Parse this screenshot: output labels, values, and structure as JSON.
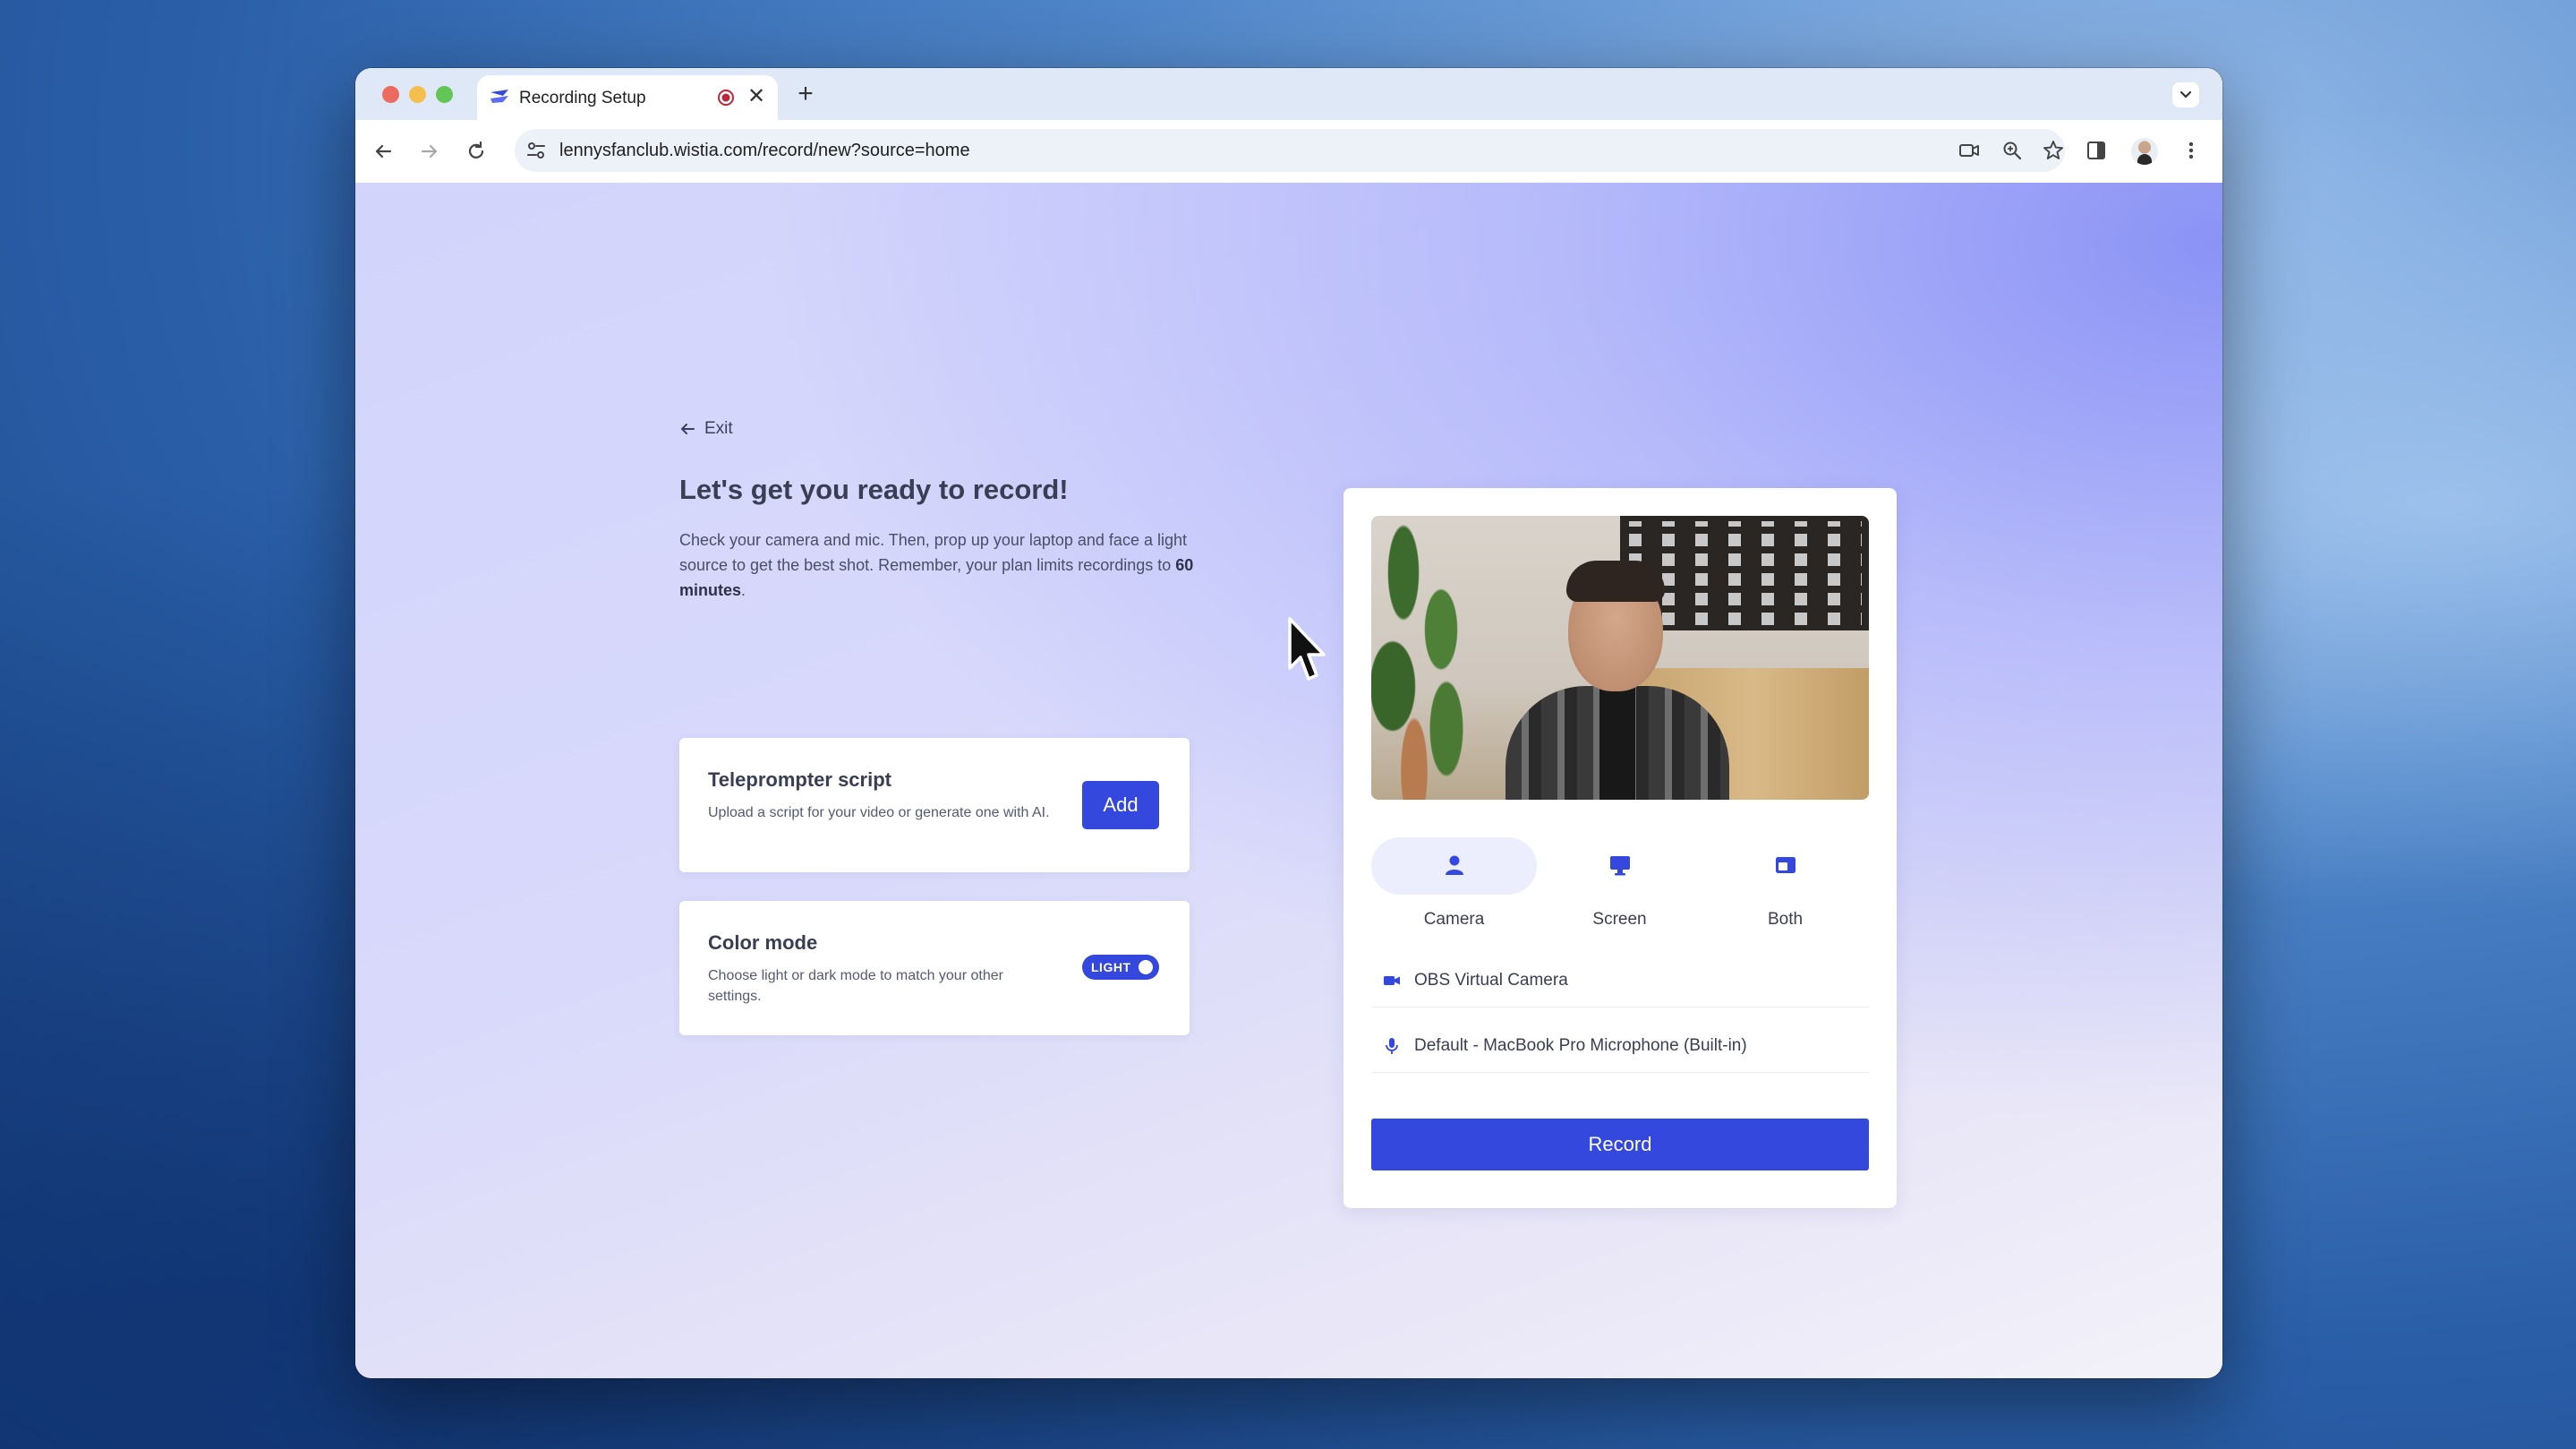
{
  "browser": {
    "tab_title": "Recording Setup",
    "url": "lennysfanclub.wistia.com/record/new?source=home"
  },
  "page": {
    "exit_label": "Exit",
    "heading": "Let's get you ready to record!",
    "intro_before": "Check your camera and mic. Then, prop up your laptop and face a light source to get the best shot. Remember, your plan limits recordings to ",
    "intro_bold": "60 minutes",
    "intro_after": ".",
    "teleprompter": {
      "title": "Teleprompter script",
      "description": "Upload a script for your video or generate one with AI.",
      "button": "Add"
    },
    "color_mode": {
      "title": "Color mode",
      "description": "Choose light or dark mode to match your other settings.",
      "toggle_label": "LIGHT"
    }
  },
  "recorder": {
    "source_tabs": [
      {
        "label": "Camera",
        "icon": "person-icon",
        "active": true
      },
      {
        "label": "Screen",
        "icon": "monitor-icon",
        "active": false
      },
      {
        "label": "Both",
        "icon": "window-icon",
        "active": false
      }
    ],
    "camera_device": "OBS Virtual Camera",
    "mic_device": "Default - MacBook Pro Microphone (Built-in)",
    "record_label": "Record"
  },
  "colors": {
    "accent": "#3448de",
    "text_dark": "#3a3e52"
  }
}
